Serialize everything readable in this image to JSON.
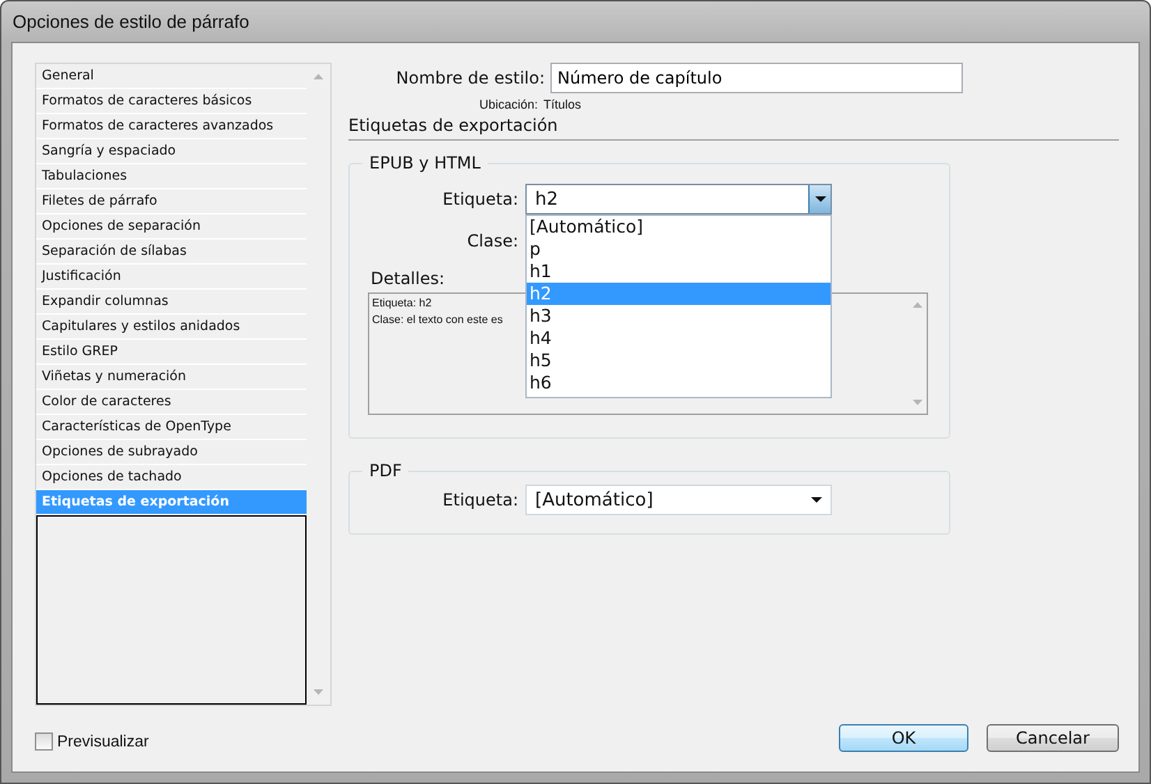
{
  "window": {
    "title": "Opciones de estilo de párrafo"
  },
  "sidebar": {
    "items": [
      {
        "label": "General",
        "selected": false
      },
      {
        "label": "Formatos de caracteres básicos",
        "selected": false
      },
      {
        "label": "Formatos de caracteres avanzados",
        "selected": false
      },
      {
        "label": "Sangría y espaciado",
        "selected": false
      },
      {
        "label": "Tabulaciones",
        "selected": false
      },
      {
        "label": "Filetes de párrafo",
        "selected": false
      },
      {
        "label": "Opciones de separación",
        "selected": false
      },
      {
        "label": "Separación de sílabas",
        "selected": false
      },
      {
        "label": "Justificación",
        "selected": false
      },
      {
        "label": "Expandir columnas",
        "selected": false
      },
      {
        "label": "Capitulares y estilos anidados",
        "selected": false
      },
      {
        "label": "Estilo GREP",
        "selected": false
      },
      {
        "label": "Viñetas y numeración",
        "selected": false
      },
      {
        "label": "Color de caracteres",
        "selected": false
      },
      {
        "label": "Características de OpenType",
        "selected": false
      },
      {
        "label": "Opciones de subrayado",
        "selected": false
      },
      {
        "label": "Opciones de tachado",
        "selected": false
      },
      {
        "label": "Etiquetas de exportación",
        "selected": true
      }
    ]
  },
  "style_name": {
    "label": "Nombre de estilo:",
    "value": "Número de capítulo"
  },
  "location": {
    "label": "Ubicación:",
    "value": "Títulos"
  },
  "section_title": "Etiquetas de exportación",
  "epub": {
    "legend": "EPUB y HTML",
    "tag_label": "Etiqueta:",
    "tag_value": "h2",
    "tag_options": [
      {
        "label": "[Automático]",
        "selected": false
      },
      {
        "label": "p",
        "selected": false
      },
      {
        "label": "h1",
        "selected": false
      },
      {
        "label": "h2",
        "selected": true
      },
      {
        "label": "h3",
        "selected": false
      },
      {
        "label": "h4",
        "selected": false
      },
      {
        "label": "h5",
        "selected": false
      },
      {
        "label": "h6",
        "selected": false
      }
    ],
    "class_label": "Clase:",
    "details_label": "Detalles:",
    "details_lines": [
      "Etiqueta: h2",
      "Clase: el texto con este es"
    ]
  },
  "pdf": {
    "legend": "PDF",
    "tag_label": "Etiqueta:",
    "tag_value": "[Automático]"
  },
  "preview": {
    "label": "Previsualizar",
    "checked": false
  },
  "buttons": [
    {
      "label": "OK",
      "kind": "default"
    },
    {
      "label": "Cancelar",
      "kind": "normal"
    }
  ]
}
